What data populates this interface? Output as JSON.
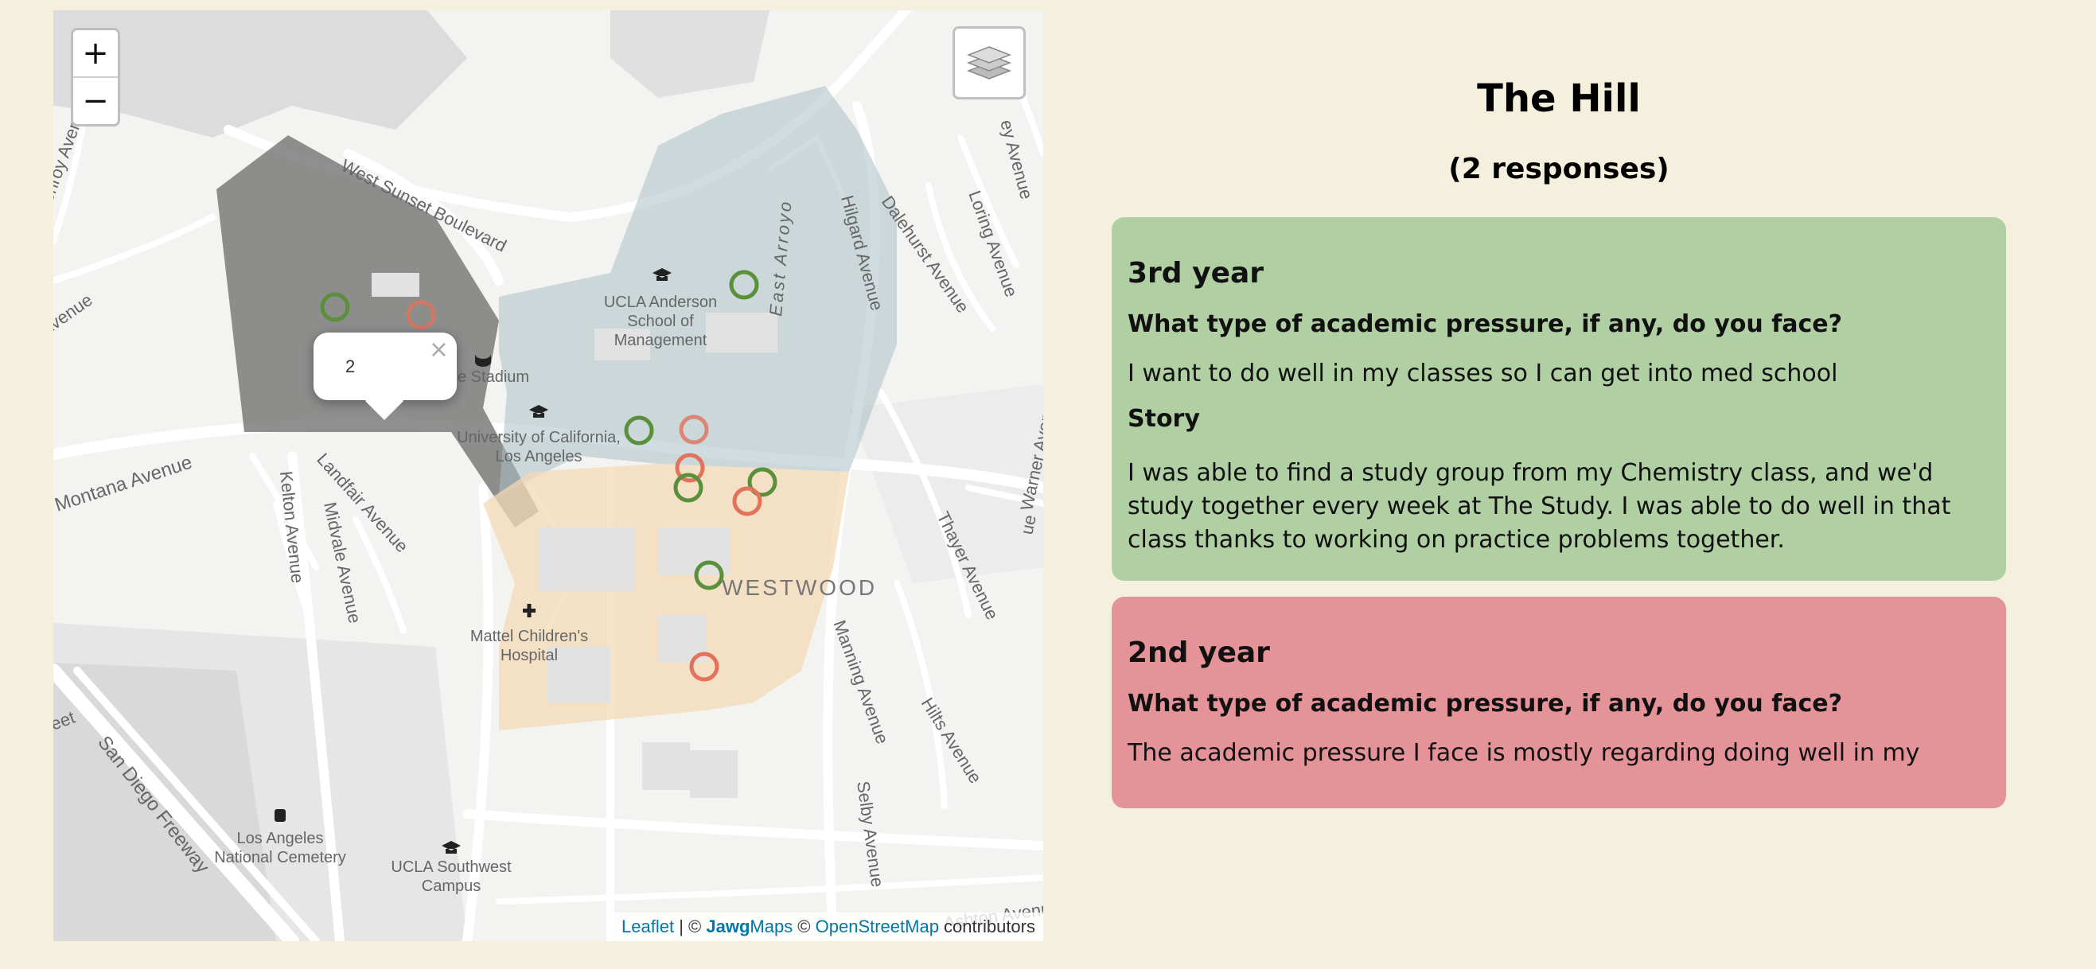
{
  "map": {
    "zoom_in": "+",
    "zoom_out": "−",
    "labels": {
      "sunset": "West Sunset Boulevard",
      "hilgard": "Hilgard Avenue",
      "east_arroyo": "East Arroyo",
      "dalehurst": "Dalehurst Avenue",
      "loring": "Loring Avenue",
      "glenroy": "North Glenroy Avenue",
      "ucla_anderson": [
        "UCLA Anderson",
        "School of",
        "Management"
      ],
      "stadium": "e Stadium",
      "ucla": [
        "University of California,",
        "Los Angeles"
      ],
      "montana": "Montana Avenue",
      "landfair": "Landfair Avenue",
      "kelton": "Kelton Avenue",
      "midvale": "Midvale Avenue",
      "westwood": "WESTWOOD",
      "thayer": "Thayer Avenue",
      "warner": "Warner Avenue",
      "manning": "Manning Avenue",
      "hilts": "Hilts Avenue",
      "selby": "Selby Avenue",
      "ashton": "Ashton Avenue",
      "mattel": [
        "Mattel Children's",
        "Hospital"
      ],
      "san_diego": "San Diego Freeway",
      "cemetery": [
        "Los Angeles",
        "National Cemetery"
      ],
      "southwest": [
        "UCLA Southwest",
        "Campus"
      ],
      "left_avenue": "Avenue",
      "left_street": "eet",
      "top_avenue": "ey Avenue",
      "right_avenue": "ue"
    },
    "popup": {
      "text": "2",
      "close": "×"
    },
    "attribution": {
      "leaflet": "Leaflet",
      "sep": " | © ",
      "jawg": "Jawg",
      "maps": "Maps",
      "osm_prefix": " © ",
      "osm": "OpenStreetMap",
      "contrib": " contributors"
    },
    "colors": {
      "hill_region": "#6f6f6f",
      "campus_region": "#a9bfc4",
      "village_region": "#f4d9b4",
      "marker_green": "#5a8f3c",
      "marker_red": "#e2725b"
    }
  },
  "panel": {
    "title": "The Hill",
    "subtitle": "(2 responses)",
    "responses": [
      {
        "year": "3rd year",
        "question": "What type of academic pressure, if any, do you face?",
        "answer": "I want to do well in my classes so I can get into med school",
        "story_label": "Story",
        "story": "I was able to find a study group from my Chemistry class, and we'd study together every week at The Study. I was able to do well in that class thanks to working on practice problems together."
      },
      {
        "year": "2nd year",
        "question": "What type of academic pressure, if any, do you face?",
        "answer": "The academic pressure I face is mostly regarding doing well in my"
      }
    ]
  }
}
